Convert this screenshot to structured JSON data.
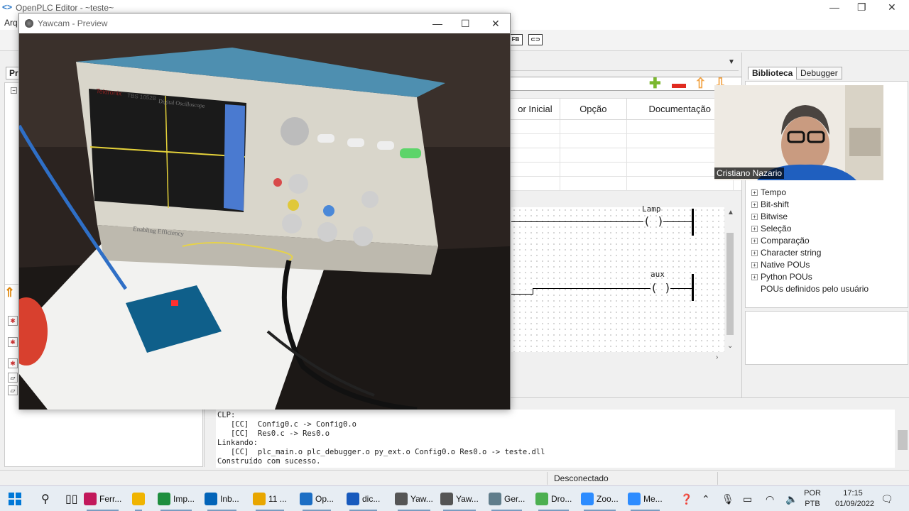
{
  "main_window": {
    "title": "OpenPLC Editor - ~teste~",
    "menu_first": "Arq",
    "toolbar_fb_label": "FB"
  },
  "left_panel": {
    "tab_label": "Pr",
    "tree_toggle": "−"
  },
  "variables": {
    "columns": [
      "or Inicial",
      "Opção",
      "Documentação"
    ],
    "row_count": 5
  },
  "ladder": {
    "coils": [
      {
        "label": "Lamp",
        "symbol": "( )"
      },
      {
        "label": "aux",
        "symbol": "( )"
      }
    ]
  },
  "library": {
    "tabs": [
      "Biblioteca",
      "Debugger"
    ],
    "items": [
      "Tempo",
      "Bit-shift",
      "Bitwise",
      "Seleção",
      "Comparação",
      "Character string",
      "Native POUs",
      "Python POUs",
      "POUs definidos pelo usuário"
    ]
  },
  "webcam_overlay": {
    "participant_name": "Cristiano Nazario"
  },
  "console": {
    "lines": [
      "CLP:",
      "   [CC]  Config0.c -> Config0.o",
      "   [CC]  Res0.c -> Res0.o",
      "Linkando:",
      "   [CC]  plc_main.o plc_debugger.o py_ext.o Config0.o Res0.o -> teste.dll",
      "Construído com sucesso."
    ]
  },
  "status": {
    "connection": "Desconectado"
  },
  "yawcam": {
    "title": "Yawcam - Preview",
    "scope_brand": "Tektronix",
    "scope_model": "TBS 1052B",
    "scope_subtitle": "Digital Oscilloscope",
    "scope_footer": "Enabling Efficiency"
  },
  "taskbar": {
    "items": [
      {
        "label": "Ferr...",
        "icon": "paint-icon",
        "color": "#c2185b"
      },
      {
        "label": "",
        "icon": "file-explorer-icon",
        "color": "#f0b400"
      },
      {
        "label": "Imp...",
        "icon": "chrome-icon",
        "color": "#1e8e3e"
      },
      {
        "label": "Inb...",
        "icon": "outlook-icon",
        "color": "#0364b8"
      },
      {
        "label": "11 ...",
        "icon": "notification-bell-icon",
        "color": "#e8a600"
      },
      {
        "label": "Op...",
        "icon": "openplc-icon",
        "color": "#1c6ec4"
      },
      {
        "label": "dic...",
        "icon": "word-icon",
        "color": "#185abd"
      },
      {
        "label": "Yaw...",
        "icon": "yawcam-icon",
        "color": "#555555"
      },
      {
        "label": "Yaw...",
        "icon": "yawcam-icon",
        "color": "#555555"
      },
      {
        "label": "Ger...",
        "icon": "gear-icon",
        "color": "#607d8b"
      },
      {
        "label": "Dro...",
        "icon": "droidcam-icon",
        "color": "#4caf50"
      },
      {
        "label": "Zoo...",
        "icon": "zoom-icon",
        "color": "#2d8cff"
      },
      {
        "label": "Me...",
        "icon": "zoom-meeting-icon",
        "color": "#2d8cff"
      }
    ],
    "language": [
      "POR",
      "PTB"
    ],
    "time": "17:15",
    "date": "01/09/2022"
  },
  "colors": {
    "accent_add": "#7cb82f",
    "accent_remove": "#e02b20",
    "arrow_orange": "#f2a64b",
    "console_bg": "#ffffff",
    "taskbar_bg": "#e7edf3"
  }
}
